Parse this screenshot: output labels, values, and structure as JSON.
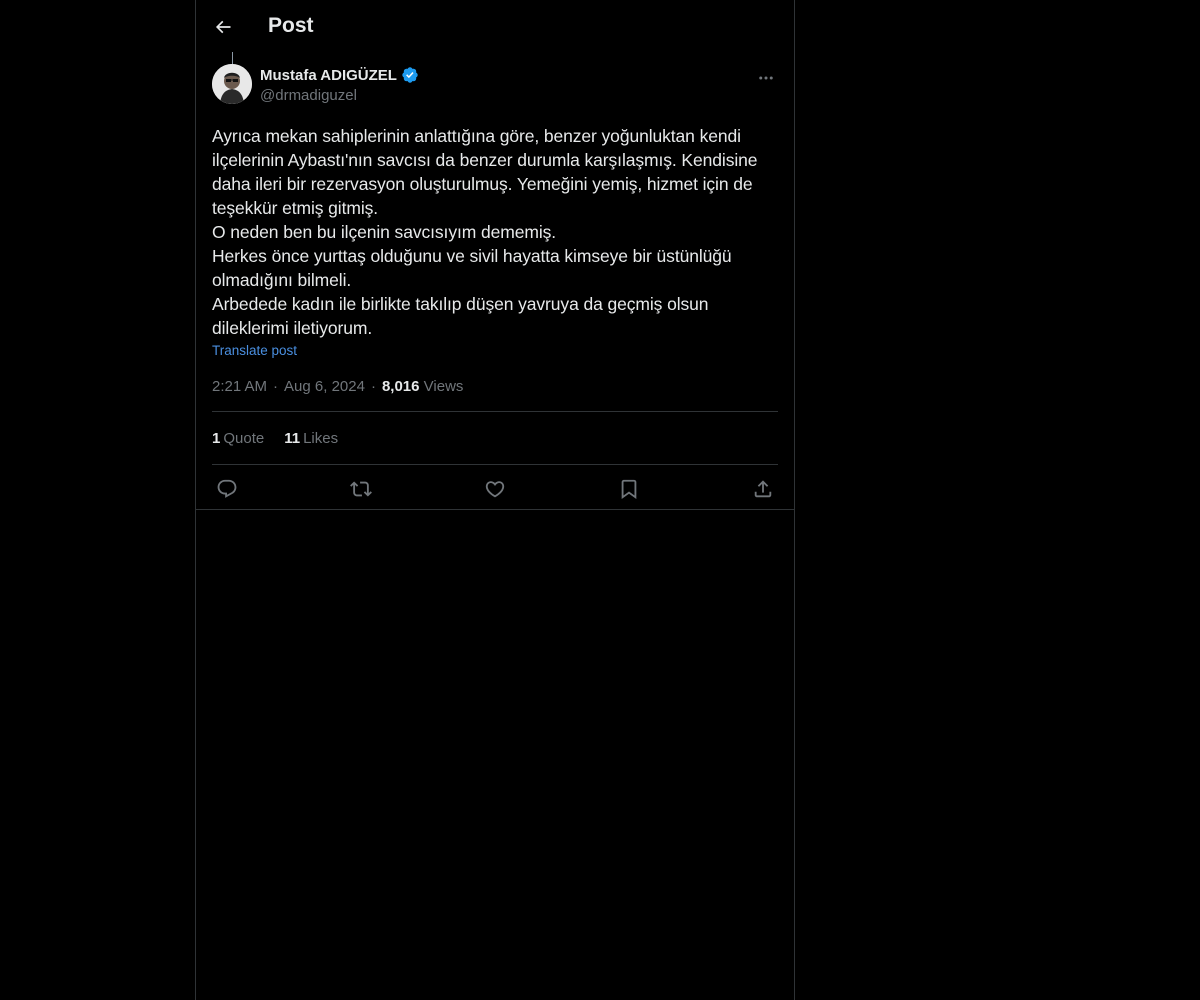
{
  "header": {
    "title": "Post"
  },
  "author": {
    "display_name": "Mustafa ADIGÜZEL",
    "handle": "@drmadiguzel"
  },
  "post": {
    "text": "Ayrıca mekan sahiplerinin anlattığına göre, benzer yoğunluktan kendi ilçelerinin Aybastı'nın savcısı da benzer durumla karşılaşmış. Kendisine daha ileri bir rezervasyon oluşturulmuş. Yemeğini yemiş, hizmet için de teşekkür etmiş gitmiş.\nO neden ben bu ilçenin savcısıyım dememiş.\nHerkes önce yurttaş olduğunu ve sivil hayatta kimseye bir üstünlüğü olmadığını bilmeli.\nArbedede kadın ile birlikte takılıp düşen yavruya da geçmiş olsun dileklerimi iletiyorum.",
    "translate_label": "Translate post",
    "time": "2:21 AM",
    "date": "Aug 6, 2024",
    "separator": "·",
    "views_count": "8,016",
    "views_label": "Views"
  },
  "stats": {
    "quotes_count": "1",
    "quotes_label": "Quote",
    "likes_count": "11",
    "likes_label": "Likes"
  },
  "icons": {
    "back": "arrow-left-icon",
    "more": "more-horizontal-icon",
    "verified": "verified-badge-icon",
    "reply": "reply-icon",
    "repost": "repost-icon",
    "like": "heart-icon",
    "bookmark": "bookmark-icon",
    "share": "share-icon"
  },
  "colors": {
    "background": "#000000",
    "text": "#e7e9ea",
    "muted": "#71767b",
    "link": "#4a8fe0",
    "verified": "#1d9bf0",
    "border": "#2f3336"
  }
}
